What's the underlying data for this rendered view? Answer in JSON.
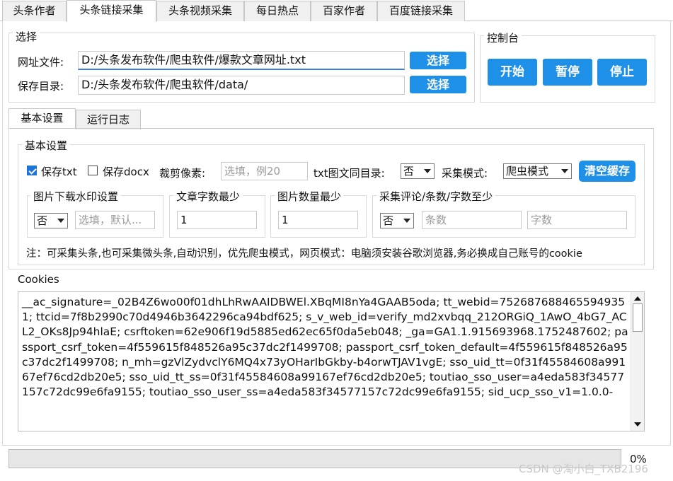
{
  "tabs": [
    "头条作者",
    "头条链接采集",
    "头条视频采集",
    "每日热点",
    "百家作者",
    "百度链接采集"
  ],
  "select_group": {
    "title": "选择",
    "url_file_label": "网址文件:",
    "url_file_value": "D:/头条发布软件/爬虫软件/爆款文章网址.txt",
    "save_dir_label": "保存目录:",
    "save_dir_value": "D:/头条发布软件/爬虫软件/data/",
    "choose_label": "选择"
  },
  "console": {
    "title": "控制台",
    "start": "开始",
    "pause": "暂停",
    "stop": "停止"
  },
  "subtabs": [
    "基本设置",
    "运行日志"
  ],
  "basic": {
    "title": "基本设置",
    "save_txt": "保存txt",
    "save_txt_checked": true,
    "save_docx": "保存docx",
    "save_docx_checked": false,
    "crop_label": "裁剪像素:",
    "crop_placeholder": "选填，例20",
    "txt_same_dir_label": "txt图文同目录:",
    "txt_same_dir_value": "否",
    "mode_label": "采集模式:",
    "mode_value": "爬虫模式",
    "clear_cache": "清空缓存",
    "watermark": {
      "title": "图片下载水印设置",
      "select_value": "否",
      "placeholder": "选填，默认..."
    },
    "min_words": {
      "title": "文章字数最少",
      "value": "1"
    },
    "min_images": {
      "title": "图片数量最少",
      "value": "1"
    },
    "comments": {
      "title": "采集评论/条数/字数至少",
      "select_value": "否",
      "count_placeholder": "条数",
      "words_placeholder": "字数"
    },
    "note": "注：可采集头条,也可采集微头条,自动识别，优先爬虫模式，网页模式：电脑须安装谷歌浏览器,务必换成自己账号的cookie"
  },
  "cookies": {
    "label": "Cookies",
    "text": "__ac_signature=_02B4Z6wo00f01dhLhRwAAIDBWEl.XBqMI8nYa4GAAB5oda; tt_webid=7526876884655949351; ttcid=7f8b2990c70d4946b3642296ca94bdf625; s_v_web_id=verify_md2xvbqq_212ORGiQ_1AwO_4bG7_ACL2_OKs8Jp94hlaE; csrftoken=62e906f19d5885ed62ec65f0da5eb048; _ga=GA1.1.915693968.1752487602; passport_csrf_token=4f559615f848526a95c37dc2f1499708; passport_csrf_token_default=4f559615f848526a95c37dc2f1499708; n_mh=gzVlZydvclY6MQ4x73yOHarIbGkby-b4orwTJAV1vgE; sso_uid_tt=0f31f45584608a99167ef76cd2db20e5; sso_uid_tt_ss=0f31f45584608a99167ef76cd2db20e5; toutiao_sso_user=a4eda583f34577157c72dc99e6fa9155; toutiao_sso_user_ss=a4eda583f34577157c72dc99e6fa9155; sid_ucp_sso_v1=1.0.0-"
  },
  "progress": {
    "value": 0,
    "label": "0%"
  },
  "watermark_text": "CSDN @淘小白_TXB2196",
  "colors": {
    "accent": "#1e90e8",
    "progress_fill": "#06b025"
  }
}
